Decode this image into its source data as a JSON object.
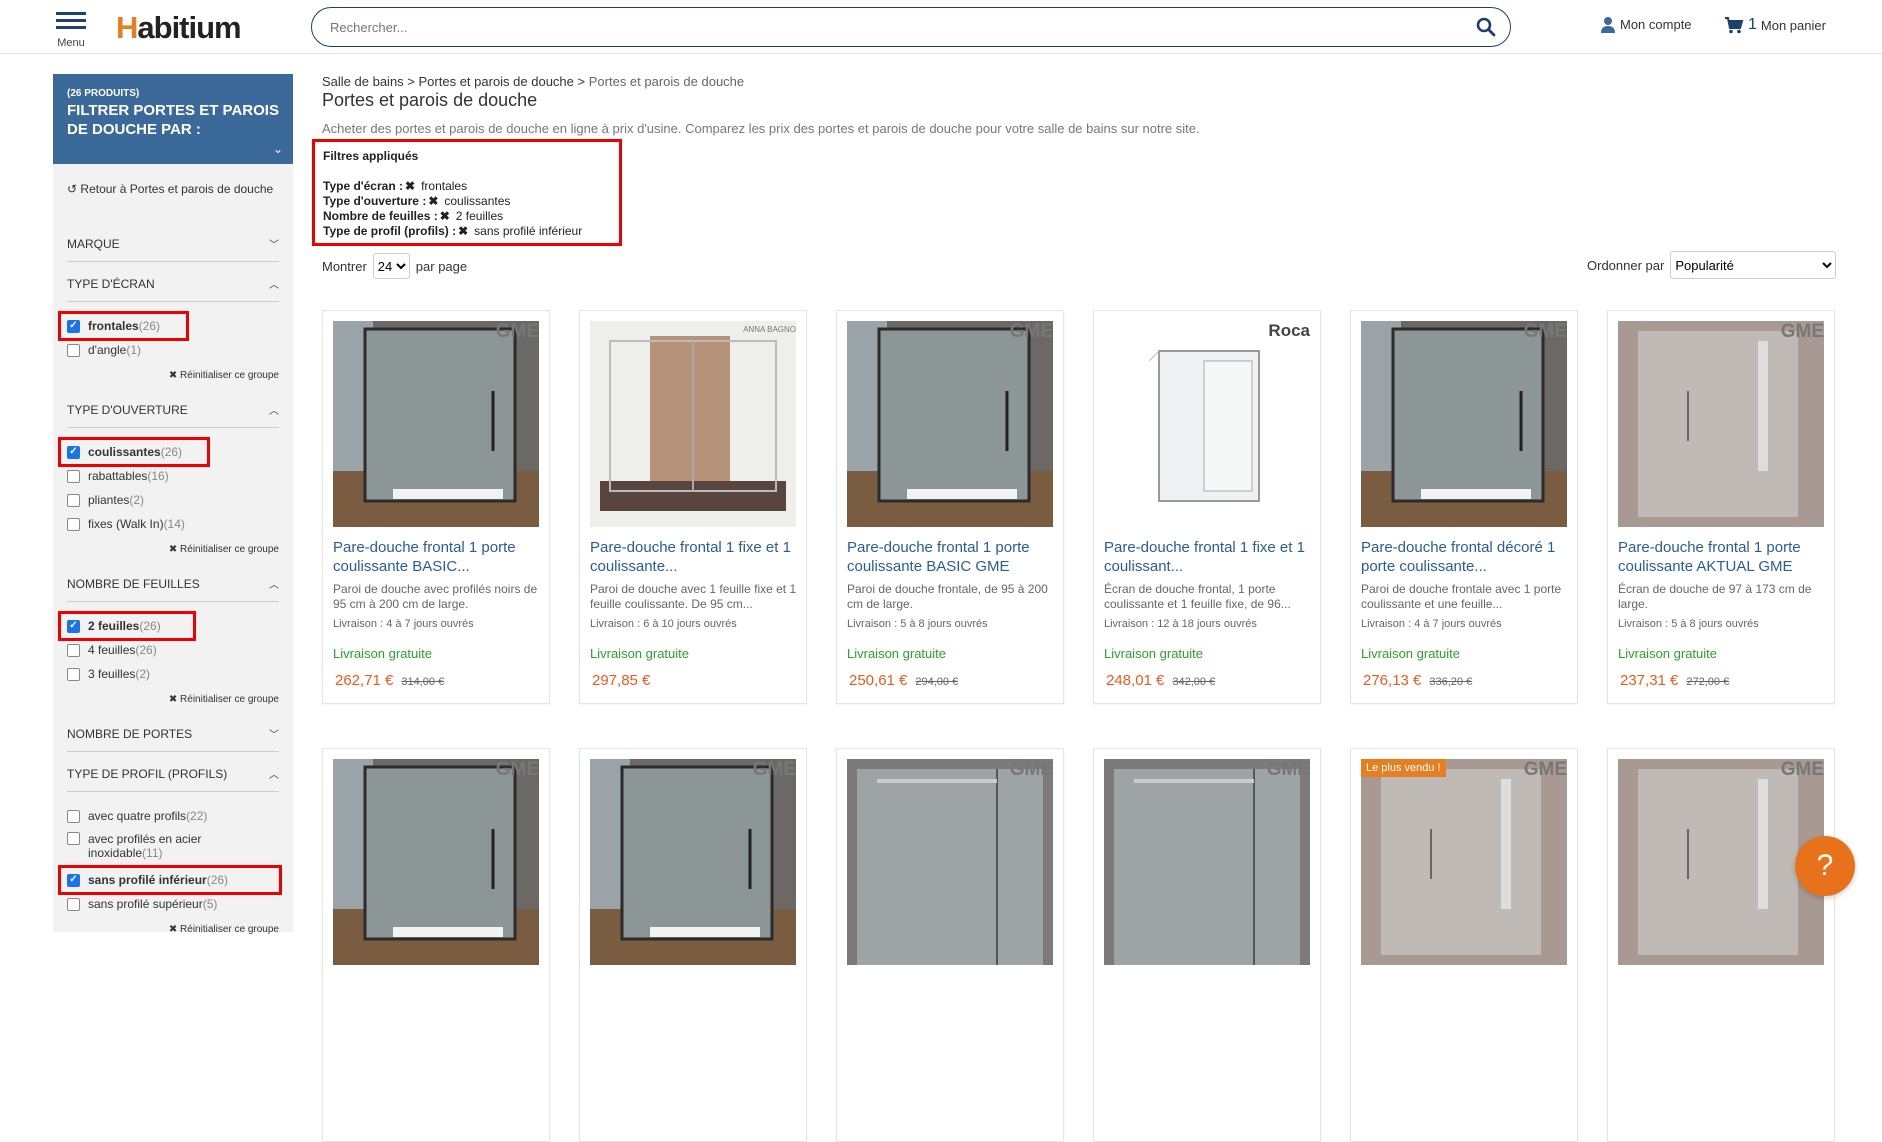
{
  "header": {
    "menu_label": "Menu",
    "logo_text": "abitium",
    "logo_letter": "H",
    "search_placeholder": "Rechercher...",
    "account_label": "Mon compte",
    "cart_count": "1",
    "cart_label": "Mon panier"
  },
  "sidebar": {
    "count_label": "(26 PRODUITS)",
    "title": "FILTRER PORTES ET PAROIS DE DOUCHE PAR :",
    "return_label": "Retour à Portes et parois de douche",
    "reset_label": "Réinitialiser ce groupe",
    "groups": [
      {
        "title": "MARQUE"
      },
      {
        "title": "TYPE D'ÉCRAN",
        "options": [
          {
            "name": "frontales",
            "count": "(26)",
            "checked": true
          },
          {
            "name": "d'angle",
            "count": "(1)",
            "checked": false
          }
        ]
      },
      {
        "title": "TYPE D'OUVERTURE",
        "options": [
          {
            "name": "coulissantes",
            "count": "(26)",
            "checked": true
          },
          {
            "name": "rabattables",
            "count": "(16)",
            "checked": false
          },
          {
            "name": "pliantes",
            "count": "(2)",
            "checked": false
          },
          {
            "name": "fixes (Walk In)",
            "count": "(14)",
            "checked": false
          }
        ]
      },
      {
        "title": "NOMBRE DE FEUILLES",
        "options": [
          {
            "name": "2 feuilles",
            "count": "(26)",
            "checked": true
          },
          {
            "name": "4 feuilles",
            "count": "(26)",
            "checked": false
          },
          {
            "name": "3 feuilles",
            "count": "(2)",
            "checked": false
          }
        ]
      },
      {
        "title": "NOMBRE DE PORTES"
      },
      {
        "title": "TYPE DE PROFIL (PROFILS)",
        "options": [
          {
            "name": "avec quatre profils",
            "count": "(22)",
            "checked": false
          },
          {
            "name": "avec profilés en acier inoxidable",
            "count": "(11)",
            "checked": false
          },
          {
            "name": "sans profilé inférieur",
            "count": "(26)",
            "checked": true
          },
          {
            "name": "sans profilé supérieur",
            "count": "(5)",
            "checked": false
          }
        ]
      }
    ]
  },
  "breadcrumb": {
    "items": [
      "Salle de bains",
      "Portes et parois de douche",
      "Portes et parois de douche"
    ],
    "separator": ">"
  },
  "main": {
    "title": "Portes et parois de douche",
    "description": "Acheter des portes et parois de douche en ligne à prix d'usine. Comparez les prix des portes et parois de douche pour votre salle de bains sur notre site."
  },
  "applied_filters": {
    "title": "Filtres appliqués",
    "rows": [
      {
        "label": "Type d'écran :",
        "value": "frontales"
      },
      {
        "label": "Type d'ouverture :",
        "value": "coulissantes"
      },
      {
        "label": "Nombre de feuilles :",
        "value": "2 feuilles"
      },
      {
        "label": "Type de profil (profils) :",
        "value": "sans profilé inférieur"
      }
    ]
  },
  "toolbar": {
    "show_label": "Montrer",
    "per_page_value": "24",
    "per_page_label": "par page",
    "sort_label": "Ordonner par",
    "sort_value": "Popularité"
  },
  "products": [
    {
      "brand": "GME",
      "name": "Pare-douche frontal 1 porte coulissante BASIC...",
      "desc": "Paroi de douche avec profilés noirs de 95 cm à 200 cm de large.",
      "delivery": "Livraison : 4 à 7 jours ouvrés",
      "free": "Livraison gratuite",
      "price": "262,71 €",
      "old": "314,00 €",
      "style": "dark"
    },
    {
      "brand": "ANNA BAGNO",
      "name": "Pare-douche frontal 1 fixe et 1 coulissante...",
      "desc": "Paroi de douche avec 1 feuille fixe et 1 feuille coulissante. De 95 cm...",
      "delivery": "Livraison : 6 à 10 jours ouvrés",
      "free": "Livraison gratuite",
      "price": "297,85 €",
      "old": "",
      "style": "tile"
    },
    {
      "brand": "GME",
      "name": "Pare-douche frontal 1 porte coulissante BASIC GME",
      "desc": "Paroi de douche frontale, de 95 à 200 cm de large.",
      "delivery": "Livraison : 5 à 8 jours ouvrés",
      "free": "Livraison gratuite",
      "price": "250,61 €",
      "old": "294,00 €",
      "style": "dark"
    },
    {
      "brand": "Roca",
      "name": "Pare-douche frontal 1 fixe et 1 coulissant...",
      "desc": "Écran de douche frontal, 1 porte coulissante et 1 feuille fixe, de 96...",
      "delivery": "Livraison : 12 à 18 jours ouvrés",
      "free": "Livraison gratuite",
      "price": "248,01 €",
      "old": "342,00 €",
      "style": "white"
    },
    {
      "brand": "GME",
      "name": "Pare-douche frontal décoré 1 porte coulissante...",
      "desc": "Paroi de douche frontale avec 1 porte coulissante et une feuille...",
      "delivery": "Livraison : 4 à 7 jours ouvrés",
      "free": "Livraison gratuite",
      "price": "276,13 €",
      "old": "336,20 €",
      "style": "dark"
    },
    {
      "brand": "GME",
      "name": "Pare-douche frontal 1 porte coulissante AKTUAL GME",
      "desc": "Écran de douche de 97 à 173 cm de large.",
      "delivery": "Livraison : 5 à 8 jours ouvrés",
      "free": "Livraison gratuite",
      "price": "237,31 €",
      "old": "272,00 €",
      "style": "stone"
    },
    {
      "brand": "GME",
      "name": "",
      "desc": "",
      "delivery": "",
      "free": "",
      "price": "",
      "old": "",
      "style": "dark"
    },
    {
      "brand": "GME",
      "name": "",
      "desc": "",
      "delivery": "",
      "free": "",
      "price": "",
      "old": "",
      "style": "dark"
    },
    {
      "brand": "GME",
      "name": "",
      "desc": "",
      "delivery": "",
      "free": "",
      "price": "",
      "old": "",
      "style": "grey"
    },
    {
      "brand": "GME",
      "name": "",
      "desc": "",
      "delivery": "",
      "free": "",
      "price": "",
      "old": "",
      "style": "grey"
    },
    {
      "brand": "GME",
      "badge": "Le plus vendu !",
      "name": "",
      "desc": "",
      "delivery": "",
      "free": "",
      "price": "",
      "old": "",
      "style": "stone"
    },
    {
      "brand": "GME",
      "name": "",
      "desc": "",
      "delivery": "",
      "free": "",
      "price": "",
      "old": "",
      "style": "stone"
    }
  ],
  "help_label": "?",
  "colors": {
    "accent": "#3b6a9a",
    "link": "#2a5c9a",
    "price": "#e85c1d",
    "free": "#2e9e2e",
    "highlight": "#ee0000",
    "help": "#e8721b"
  }
}
